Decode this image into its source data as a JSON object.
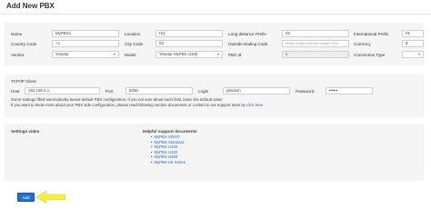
{
  "page": {
    "title": "Add New PBX",
    "add_button": "Add"
  },
  "row1": {
    "name_label": "Name",
    "name_value": "MyPBX1",
    "location_label": "Location",
    "location_value": "HQ",
    "ld_prefix_label": "Long distance Prefix",
    "ld_prefix_value": "02",
    "intl_prefix_label": "International Prefix",
    "intl_prefix_value": "01"
  },
  "row2": {
    "country_label": "Country Code",
    "country_value": "+1",
    "city_label": "City Code",
    "city_value": "02",
    "outside_label": "Outside Dialing Code",
    "outside_placeholder": "Prefix to dial external number from",
    "currency_label": "Currency",
    "currency_value": "$"
  },
  "row3": {
    "vendor_label": "Vendor",
    "vendor_value": "Yeastar",
    "model_label": "Model",
    "model_value": "Yeastar MyPBX U100",
    "pbxid_label": "PBX Id",
    "pbxid_value": "6",
    "conn_label": "Connection Type",
    "conn_value": ""
  },
  "tcp": {
    "section_label": "TCP/IP Client",
    "host_label": "Host",
    "host_value": "192.168.5.1",
    "port_label": "Port",
    "port_value": "5038",
    "login_label": "Login",
    "login_value": "pbxdom",
    "password_label": "Password",
    "password_value": "••••••",
    "note1": "Some settings filled automatically based default PBX configuration, if you not sure about each field, leave the default value",
    "note2": "If you want to know more about your PBX side configuration, please read following section documents or contact to our support team by",
    "note2_link": "click here"
  },
  "support": {
    "settings_video_label": "Settings video",
    "docs_heading": "Helpful support documents",
    "docs": [
      "MyPBX SOHO",
      "MyPBX Standard",
      "MyPBX U100",
      "MyPBX U200",
      "MyPBX U300",
      "MyPBX U5 Series"
    ]
  },
  "colors": {
    "accent": "#1f6fd6",
    "link": "#2a6bb8",
    "arrow": "#f2ee4a"
  }
}
